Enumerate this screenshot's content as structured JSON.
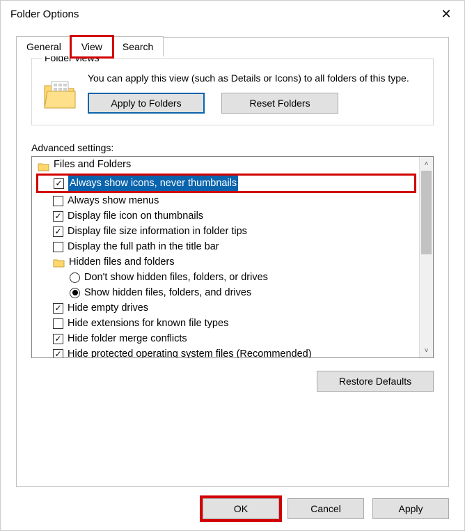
{
  "window": {
    "title": "Folder Options"
  },
  "tabs": {
    "general": "General",
    "view": "View",
    "search": "Search"
  },
  "folderViews": {
    "legend": "Folder views",
    "description": "You can apply this view (such as Details or Icons) to all folders of this type.",
    "applyBtn": "Apply to Folders",
    "resetBtn": "Reset Folders"
  },
  "advanced": {
    "label": "Advanced settings:",
    "root": "Files and Folders",
    "alwaysIcons": "Always show icons, never thumbnails",
    "alwaysMenus": "Always show menus",
    "displayFileIcon": "Display file icon on thumbnails",
    "displayFileSize": "Display file size information in folder tips",
    "displayFullPath": "Display the full path in the title bar",
    "hiddenGroup": "Hidden files and folders",
    "dontShowHidden": "Don't show hidden files, folders, or drives",
    "showHidden": "Show hidden files, folders, and drives",
    "hideEmpty": "Hide empty drives",
    "hideExt": "Hide extensions for known file types",
    "hideMerge": "Hide folder merge conflicts",
    "hideProtected": "Hide protected operating system files (Recommended)"
  },
  "buttons": {
    "restoreDefaults": "Restore Defaults",
    "ok": "OK",
    "cancel": "Cancel",
    "apply": "Apply"
  }
}
